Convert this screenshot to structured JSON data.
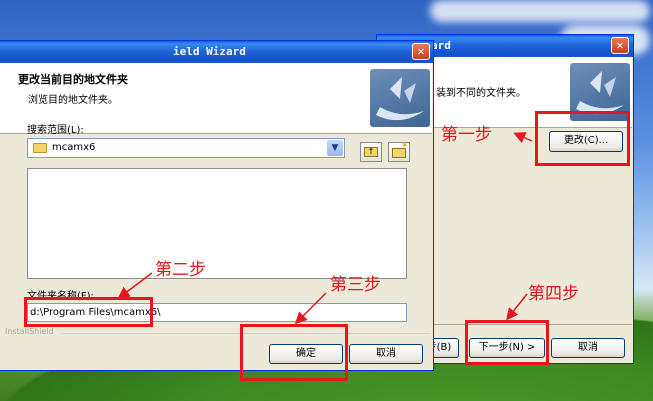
{
  "desktop": {},
  "back_window": {
    "title": "ard",
    "subtitle_fragment": "装到不同的文件夹。",
    "change_button": "更改(C)...",
    "prev_button_fragment": "步(B)",
    "next_button": "下一步(N) >",
    "cancel_button": "取消"
  },
  "front_window": {
    "title": "ield Wizard",
    "header_title": "更改当前目的地文件夹",
    "header_subtitle": "浏览目的地文件夹。",
    "search_label": "搜索范围(L):",
    "search_value": "mcamx6",
    "folder_name_label": "文件夹名称(F):",
    "folder_name_value": "d:\\Program Files\\mcamx6\\",
    "installshield_text": "InstallShield",
    "ok_button": "确定",
    "cancel_button": "取消"
  },
  "annotations": {
    "step1": "第一步",
    "step2": "第二步",
    "step3": "第三步",
    "step4": "第四步"
  },
  "colors": {
    "annotation_red": "#e8141e",
    "titlebar_blue": "#1f60d8",
    "window_bg": "#ece9d8"
  }
}
